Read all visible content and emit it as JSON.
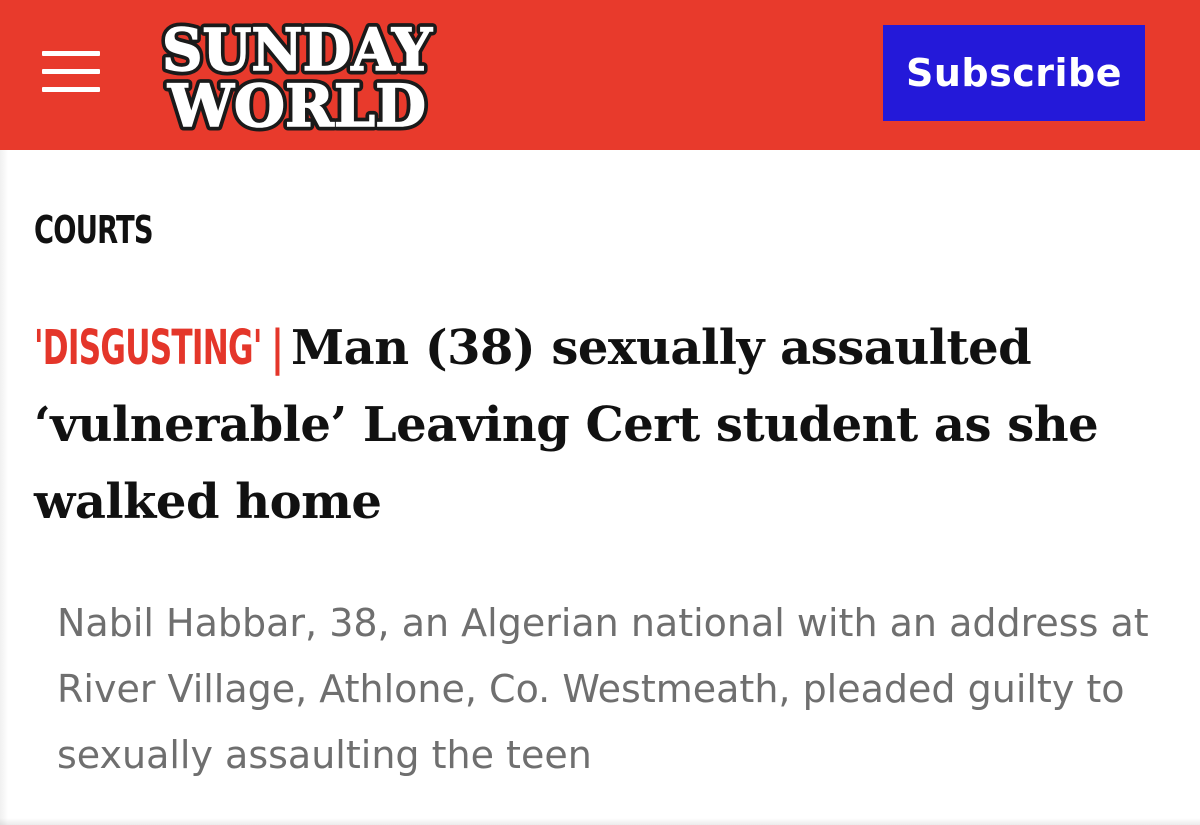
{
  "header": {
    "menu_icon": "hamburger-menu-icon",
    "logo_line1": "SUNDAY",
    "logo_line2": "WORLD",
    "subscribe_label": "Subscribe",
    "colors": {
      "bar": "#e83a2c",
      "subscribe_bg": "#2419d9",
      "logo_text": "#ffffff"
    }
  },
  "article": {
    "section": "COURTS",
    "kicker": "'DISGUSTING'",
    "kicker_separator": "|",
    "headline": "Man (38) sexually assaulted ‘vulnerable’ Leaving Cert student as she walked home",
    "standfirst": "Nabil Habbar, 38, an Algerian national with an address at River Village, Athlone, Co. Westmeath, pleaded guilty to sexually assaulting the teen",
    "colors": {
      "kicker": "#e4362a",
      "headline": "#111111",
      "standfirst": "#6f6f6f"
    }
  }
}
